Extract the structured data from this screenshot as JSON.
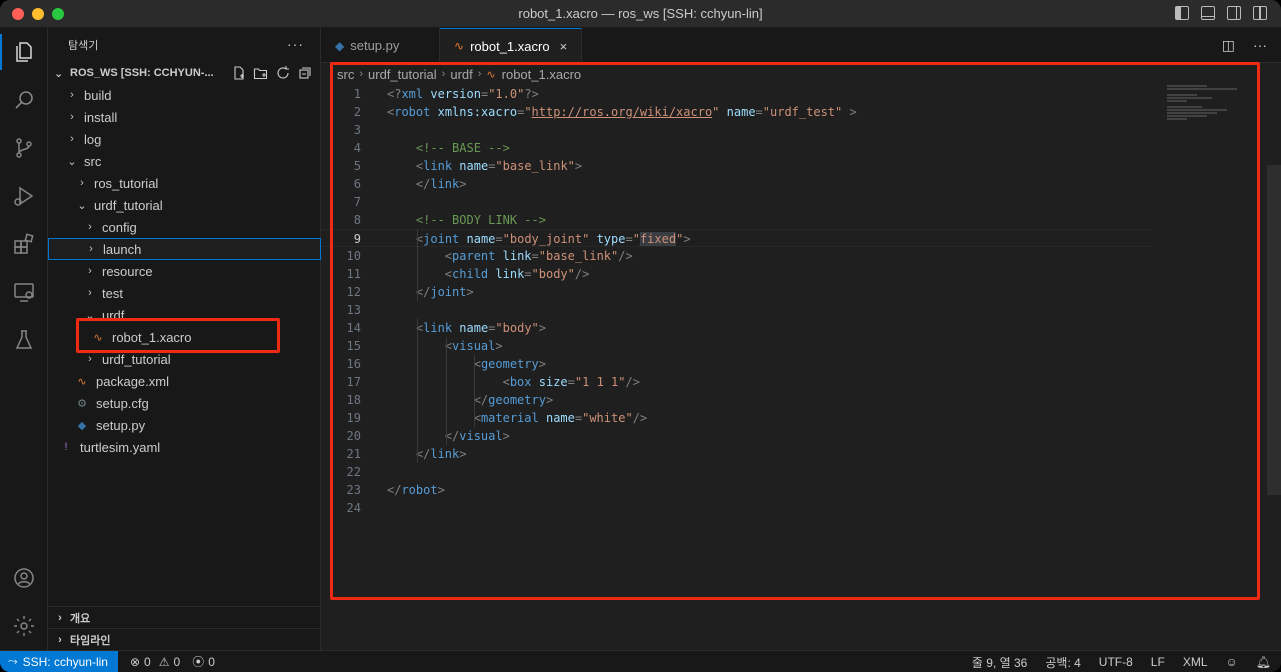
{
  "window": {
    "title": "robot_1.xacro — ros_ws [SSH: cchyun-lin]"
  },
  "activity": [
    "explorer-icon",
    "search-icon",
    "source-control-icon",
    "run-debug-icon",
    "extensions-icon",
    "remote-explorer-icon",
    "testing-icon",
    "account-icon",
    "settings-gear-icon"
  ],
  "sidebar": {
    "header": "탐색기",
    "more": "···",
    "workspace": "ROS_WS [SSH: CCHYUN-...",
    "tree": [
      {
        "label": "build",
        "chevron": "›",
        "icon": ""
      },
      {
        "label": "install",
        "chevron": "›",
        "icon": ""
      },
      {
        "label": "log",
        "chevron": "›",
        "icon": ""
      },
      {
        "label": "src",
        "chevron": "⌄",
        "icon": ""
      },
      {
        "label": "ros_tutorial",
        "chevron": "›",
        "icon": ""
      },
      {
        "label": "urdf_tutorial",
        "chevron": "⌄",
        "icon": ""
      },
      {
        "label": "config",
        "chevron": "›",
        "icon": ""
      },
      {
        "label": "launch",
        "chevron": "›",
        "icon": ""
      },
      {
        "label": "resource",
        "chevron": "›",
        "icon": ""
      },
      {
        "label": "test",
        "chevron": "›",
        "icon": ""
      },
      {
        "label": "urdf",
        "chevron": "⌄",
        "icon": ""
      },
      {
        "label": "robot_1.xacro",
        "chevron": "",
        "icon": "rss"
      },
      {
        "label": "urdf_tutorial",
        "chevron": "›",
        "icon": ""
      },
      {
        "label": "package.xml",
        "chevron": "",
        "icon": "rss"
      },
      {
        "label": "setup.cfg",
        "chevron": "",
        "icon": "gear"
      },
      {
        "label": "setup.py",
        "chevron": "",
        "icon": "python"
      },
      {
        "label": "turtlesim.yaml",
        "chevron": "",
        "icon": "yaml"
      }
    ],
    "outline": "개요",
    "timeline": "타임라인"
  },
  "tabs": [
    {
      "label": "setup.py",
      "icon": "python"
    },
    {
      "label": "robot_1.xacro",
      "icon": "rss",
      "close": "×"
    }
  ],
  "breadcrumb": [
    "src",
    "urdf_tutorial",
    "urdf",
    "robot_1.xacro"
  ],
  "editor": {
    "current_line": 9,
    "lines": [
      [
        [
          "b",
          "<?"
        ],
        [
          "t",
          "xml"
        ],
        [
          "s",
          " "
        ],
        [
          "a",
          "version"
        ],
        [
          "b",
          "="
        ],
        [
          "v",
          "\"1.0\""
        ],
        [
          "b",
          "?>"
        ]
      ],
      [
        [
          "b",
          "<"
        ],
        [
          "t",
          "robot"
        ],
        [
          "s",
          " "
        ],
        [
          "a",
          "xmlns:xacro"
        ],
        [
          "b",
          "="
        ],
        [
          "v",
          "\""
        ],
        [
          "l",
          "http://ros.org/wiki/xacro"
        ],
        [
          "v",
          "\""
        ],
        [
          "s",
          " "
        ],
        [
          "a",
          "name"
        ],
        [
          "b",
          "="
        ],
        [
          "v",
          "\"urdf_test\""
        ],
        [
          "s",
          " "
        ],
        [
          "b",
          ">"
        ]
      ],
      [],
      [
        [
          "s",
          "    "
        ],
        [
          "c",
          "<!-- BASE -->"
        ]
      ],
      [
        [
          "s",
          "    "
        ],
        [
          "b",
          "<"
        ],
        [
          "t",
          "link"
        ],
        [
          "s",
          " "
        ],
        [
          "a",
          "name"
        ],
        [
          "b",
          "="
        ],
        [
          "v",
          "\"base_link\""
        ],
        [
          "b",
          ">"
        ]
      ],
      [
        [
          "s",
          "    "
        ],
        [
          "b",
          "</"
        ],
        [
          "t",
          "link"
        ],
        [
          "b",
          ">"
        ]
      ],
      [],
      [
        [
          "s",
          "    "
        ],
        [
          "c",
          "<!-- BODY LINK -->"
        ]
      ],
      [
        [
          "s",
          "    "
        ],
        [
          "b",
          "<"
        ],
        [
          "t",
          "joint"
        ],
        [
          "s",
          " "
        ],
        [
          "a",
          "name"
        ],
        [
          "b",
          "="
        ],
        [
          "v",
          "\"body_joint\""
        ],
        [
          "s",
          " "
        ],
        [
          "a",
          "type"
        ],
        [
          "b",
          "="
        ],
        [
          "v",
          "\""
        ],
        [
          "h",
          "fixed"
        ],
        [
          "v",
          "\""
        ],
        [
          "b",
          ">"
        ]
      ],
      [
        [
          "s",
          "        "
        ],
        [
          "b",
          "<"
        ],
        [
          "t",
          "parent"
        ],
        [
          "s",
          " "
        ],
        [
          "a",
          "link"
        ],
        [
          "b",
          "="
        ],
        [
          "v",
          "\"base_link\""
        ],
        [
          "b",
          "/>"
        ]
      ],
      [
        [
          "s",
          "        "
        ],
        [
          "b",
          "<"
        ],
        [
          "t",
          "child"
        ],
        [
          "s",
          " "
        ],
        [
          "a",
          "link"
        ],
        [
          "b",
          "="
        ],
        [
          "v",
          "\"body\""
        ],
        [
          "b",
          "/>"
        ]
      ],
      [
        [
          "s",
          "    "
        ],
        [
          "b",
          "</"
        ],
        [
          "t",
          "joint"
        ],
        [
          "b",
          ">"
        ]
      ],
      [],
      [
        [
          "s",
          "    "
        ],
        [
          "b",
          "<"
        ],
        [
          "t",
          "link"
        ],
        [
          "s",
          " "
        ],
        [
          "a",
          "name"
        ],
        [
          "b",
          "="
        ],
        [
          "v",
          "\"body\""
        ],
        [
          "b",
          ">"
        ]
      ],
      [
        [
          "s",
          "        "
        ],
        [
          "b",
          "<"
        ],
        [
          "t",
          "visual"
        ],
        [
          "b",
          ">"
        ]
      ],
      [
        [
          "s",
          "            "
        ],
        [
          "b",
          "<"
        ],
        [
          "t",
          "geometry"
        ],
        [
          "b",
          ">"
        ]
      ],
      [
        [
          "s",
          "                "
        ],
        [
          "b",
          "<"
        ],
        [
          "t",
          "box"
        ],
        [
          "s",
          " "
        ],
        [
          "a",
          "size"
        ],
        [
          "b",
          "="
        ],
        [
          "v",
          "\"1 1 1\""
        ],
        [
          "b",
          "/>"
        ]
      ],
      [
        [
          "s",
          "            "
        ],
        [
          "b",
          "</"
        ],
        [
          "t",
          "geometry"
        ],
        [
          "b",
          ">"
        ]
      ],
      [
        [
          "s",
          "            "
        ],
        [
          "b",
          "<"
        ],
        [
          "t",
          "material"
        ],
        [
          "s",
          " "
        ],
        [
          "a",
          "name"
        ],
        [
          "b",
          "="
        ],
        [
          "v",
          "\"white\""
        ],
        [
          "b",
          "/>"
        ]
      ],
      [
        [
          "s",
          "        "
        ],
        [
          "b",
          "</"
        ],
        [
          "t",
          "visual"
        ],
        [
          "b",
          ">"
        ]
      ],
      [
        [
          "s",
          "    "
        ],
        [
          "b",
          "</"
        ],
        [
          "t",
          "link"
        ],
        [
          "b",
          ">"
        ]
      ],
      [],
      [
        [
          "b",
          "</"
        ],
        [
          "t",
          "robot"
        ],
        [
          "b",
          ">"
        ]
      ],
      []
    ]
  },
  "status": {
    "remote": "SSH: cchyun-lin",
    "errors": "0",
    "warnings": "0",
    "ports": "0",
    "position": "줄 9, 열 36",
    "spaces": "공백: 4",
    "encoding": "UTF-8",
    "eol": "LF",
    "language": "XML"
  },
  "colors": {
    "accent": "#0078d4",
    "highlight_box": "#f12a14",
    "rss": "#e37933",
    "python": "#3572a5",
    "yaml": "#a074c4"
  }
}
